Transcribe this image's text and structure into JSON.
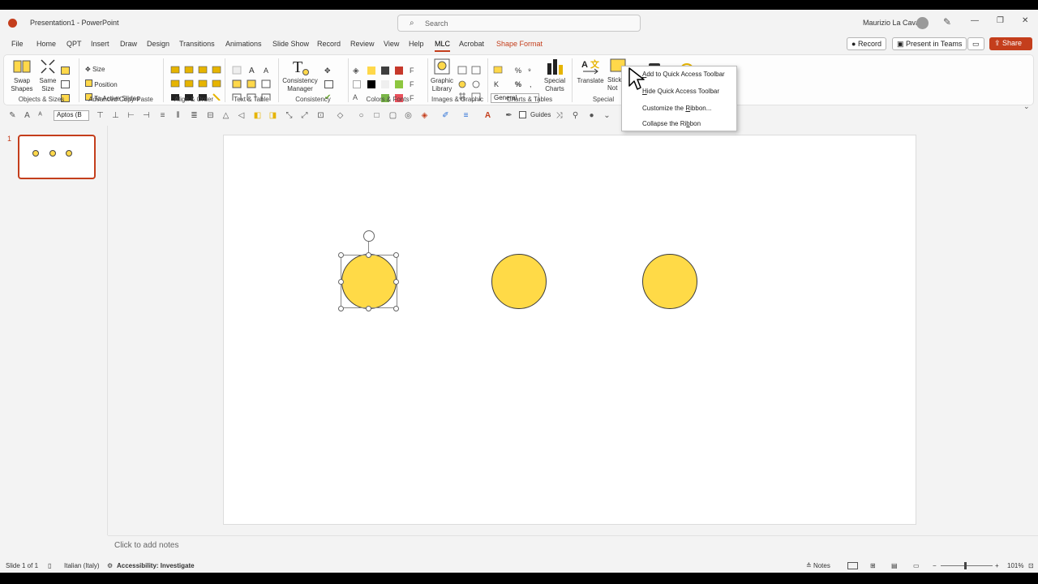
{
  "window": {
    "title": "Presentation1 - PowerPoint",
    "search_placeholder": "Search",
    "user_name": "Maurizio La Cava",
    "controls": [
      "—",
      "❐",
      "✕"
    ]
  },
  "tabs": [
    {
      "label": "File"
    },
    {
      "label": "Home"
    },
    {
      "label": "QPT"
    },
    {
      "label": "Insert"
    },
    {
      "label": "Draw"
    },
    {
      "label": "Design"
    },
    {
      "label": "Transitions"
    },
    {
      "label": "Animations"
    },
    {
      "label": "Slide Show"
    },
    {
      "label": "Record"
    },
    {
      "label": "Review"
    },
    {
      "label": "View"
    },
    {
      "label": "Help"
    },
    {
      "label": "MLC"
    },
    {
      "label": "Acrobat"
    },
    {
      "label": "Shape Format"
    }
  ],
  "top_buttons": {
    "record": "Record",
    "teams": "Present in Teams",
    "share": "Share"
  },
  "ribbon": {
    "groups": {
      "objects_sizes": "Objects & Sizes",
      "advanced_copy_paste": "Advanced Copy-Paste",
      "align_order": "Align & Order",
      "text_table": "Text & Table",
      "consistency": "Consistency",
      "colors_fonts": "Colors & Fonts",
      "images_graphic": "Images & Graphic",
      "charts_tables": "Charts & Tables",
      "special": "Special"
    },
    "buttons": {
      "swap_shapes": "Swap\nShapes",
      "same_size": "Same\nSize",
      "size": "Size",
      "position": "Position",
      "to_active_slides": "To Active Slides",
      "consistency_manager": "Consistency\nManager",
      "graphic_library": "Graphic\nLibrary",
      "number_format": "General",
      "special_charts": "Special\nCharts",
      "translate": "Translate",
      "sticky_notes": "Stick\nNot"
    },
    "swatch_colors": [
      "#ffd84a",
      "#3f3f3f",
      "#c6382b",
      "#000000",
      "#efefef",
      "#8dc63f",
      "#7ab648",
      "#e8505b"
    ]
  },
  "qat": {
    "font_name": "Aptos (B",
    "guides": "Guides"
  },
  "slides_panel": {
    "slide_number": "1"
  },
  "notes": {
    "placeholder": "Click to add notes"
  },
  "status": {
    "slide_info": "Slide 1 of 1",
    "language": "Italian (Italy)",
    "accessibility": "Accessibility: Investigate",
    "notes": "Notes",
    "zoom": "101%"
  },
  "context_menu": {
    "items": [
      {
        "accel": "A",
        "rest": "dd to Quick Access Toolbar"
      },
      {
        "accel": "H",
        "rest": "ide Quick Access Toolbar"
      },
      {
        "accel": "",
        "rest": "Customize the ",
        "accel2": "R",
        "rest2": "ibbon..."
      },
      {
        "accel": "",
        "rest": "Collapse the Ri",
        "accel2": "b",
        "rest2": "bon"
      }
    ]
  },
  "colors": {
    "accent": "#c43e1c",
    "shape_fill": "#ffda47"
  }
}
